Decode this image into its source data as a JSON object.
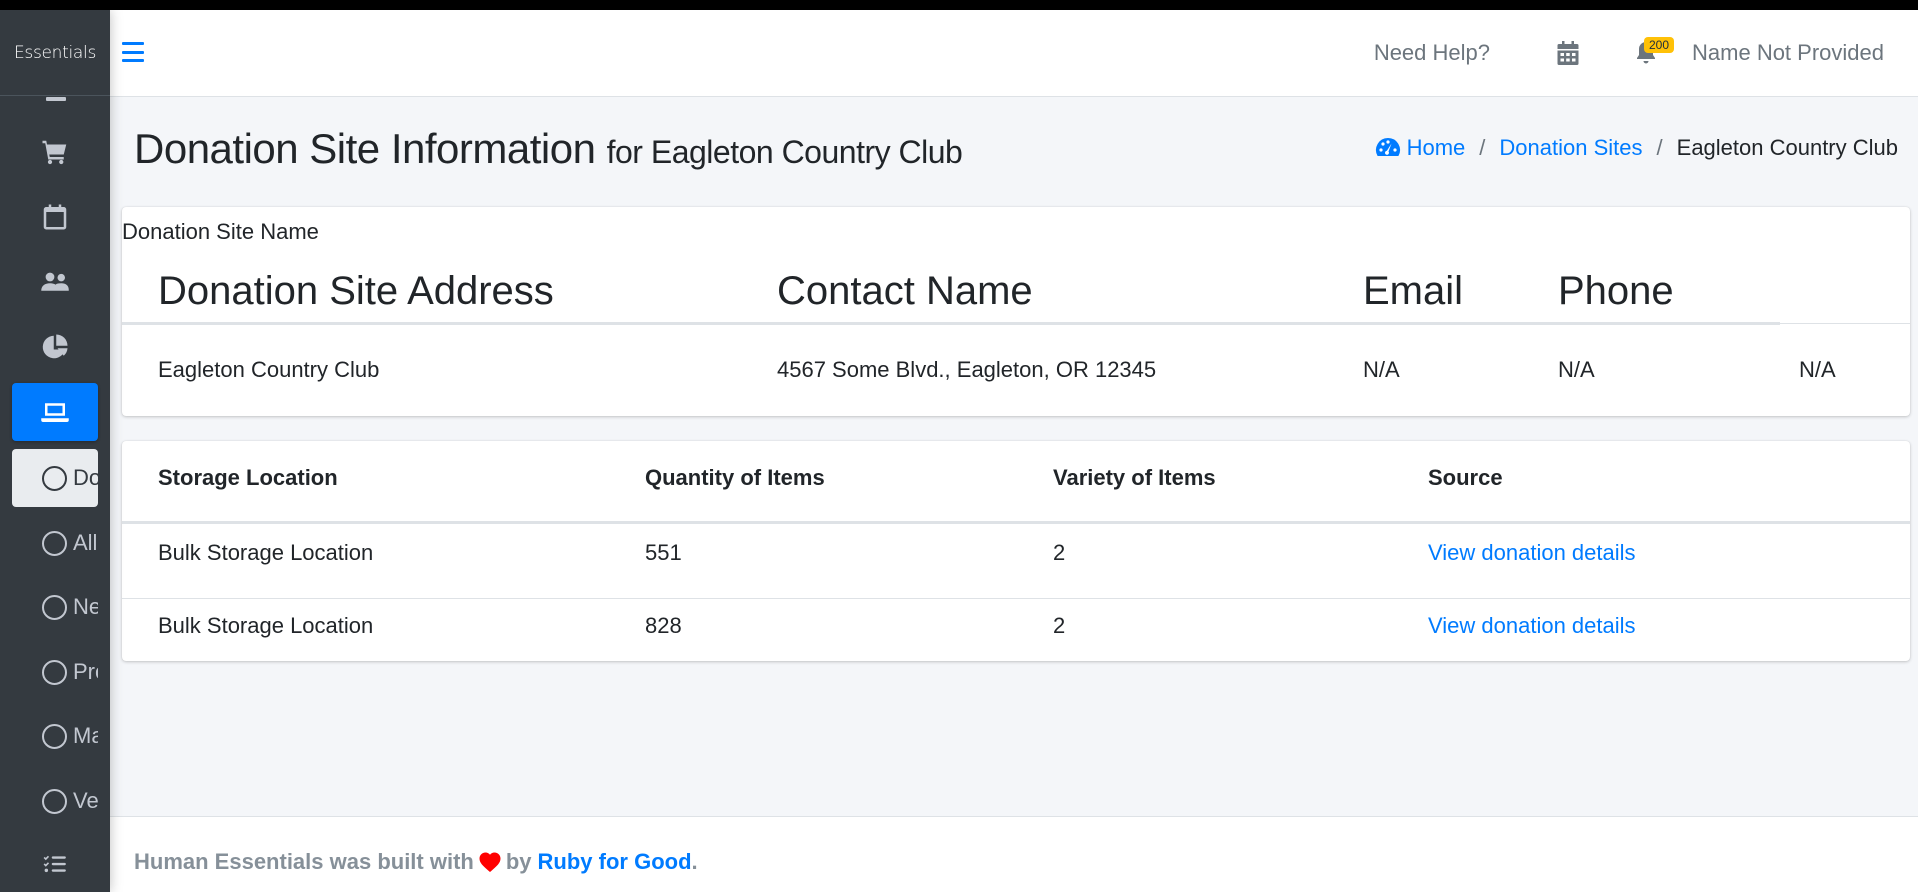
{
  "app": {
    "brand": "Essentials"
  },
  "sidebar": {
    "icon_items": [
      {
        "icon": "cart-icon",
        "label": "Purchases"
      },
      {
        "icon": "calendar-icon",
        "label": "Distributions"
      },
      {
        "icon": "users-icon",
        "label": "Partner Agencies"
      },
      {
        "icon": "pie-chart-icon",
        "label": "Reports"
      },
      {
        "icon": "laptop-icon",
        "label": "Community",
        "active": true
      }
    ],
    "sub_items": [
      {
        "label": "Donation Sites",
        "current": true
      },
      {
        "label": "All Partners"
      },
      {
        "label": "New Partner"
      },
      {
        "label": "Product Drives"
      },
      {
        "label": "Manufacturers"
      },
      {
        "label": "Vendors"
      }
    ],
    "bottom_icon": "tasks-icon"
  },
  "topbar": {
    "help": "Need Help?",
    "notification_count": "200",
    "user_name": "Name Not Provided"
  },
  "header": {
    "title": "Donation Site Information",
    "subtitle": "for Eagleton Country Club"
  },
  "breadcrumb": {
    "home": "Home",
    "parent": "Donation Sites",
    "current": "Eagleton Country Club"
  },
  "site_table": {
    "caption": "Donation Site Name",
    "headers": [
      "Donation Site Address",
      "Contact Name",
      "Email",
      "Phone"
    ],
    "row": [
      "Eagleton Country Club",
      "4567 Some Blvd., Eagleton, OR 12345",
      "N/A",
      "N/A",
      "N/A"
    ]
  },
  "donations_table": {
    "headers": [
      "Storage Location",
      "Quantity of Items",
      "Variety of Items",
      "Source"
    ],
    "rows": [
      {
        "location": "Bulk Storage Location",
        "quantity": "551",
        "variety": "2",
        "source": "View donation details"
      },
      {
        "location": "Bulk Storage Location",
        "quantity": "828",
        "variety": "2",
        "source": "View donation details"
      }
    ]
  },
  "footer": {
    "prefix": "Human Essentials was built with",
    "by": "by",
    "link": "Ruby for Good",
    "suffix": "."
  },
  "colors": {
    "accent": "#007bff",
    "sidebar_bg": "#343a40",
    "badge": "#ffc107",
    "heart": "#ff0000"
  }
}
